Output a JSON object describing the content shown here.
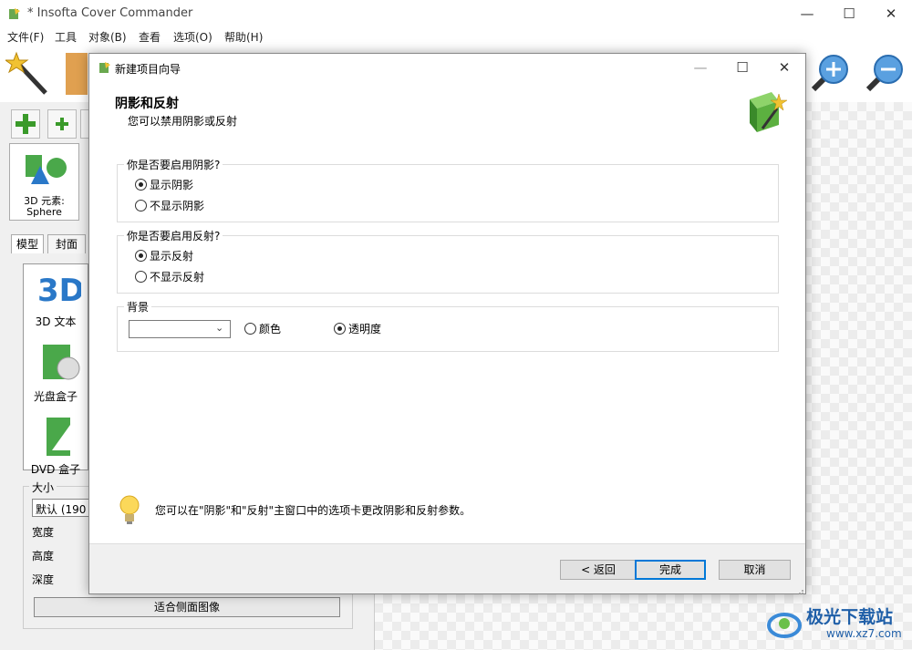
{
  "window": {
    "title": "* Insofta Cover Commander",
    "controls": [
      "—",
      "☐",
      "✕"
    ]
  },
  "menu": [
    "文件(F)",
    "工具",
    "对象(B)",
    "查看",
    "选项(O)",
    "帮助(H)"
  ],
  "left_panel": {
    "element_label_line1": "3D 元素:",
    "element_label_line2": "Sphere",
    "tabs": [
      "模型",
      "封面"
    ],
    "models": [
      "3D 文本",
      "光盘盒子",
      "DVD 盒子"
    ],
    "size_group": {
      "legend": "大小",
      "preset_value": "默认 (190 m",
      "fields": [
        "宽度",
        "高度",
        "深度"
      ],
      "fit_button": "适合侧面图像"
    }
  },
  "dialog": {
    "title": "新建项目向导",
    "controls": [
      "—",
      "☐",
      "✕"
    ],
    "header_title": "阴影和反射",
    "header_subtitle": "您可以禁用阴影或反射",
    "shadow": {
      "legend": "你是否要启用阴影?",
      "options": [
        "显示阴影",
        "不显示阴影"
      ],
      "selected": 0
    },
    "reflection": {
      "legend": "你是否要启用反射?",
      "options": [
        "显示反射",
        "不显示反射"
      ],
      "selected": 0
    },
    "background": {
      "legend": "背景",
      "dropdown_value": "",
      "options": [
        "颜色",
        "透明度"
      ],
      "selected": 1
    },
    "hint": "您可以在\"阴影\"和\"反射\"主窗口中的选项卡更改阴影和反射参数。",
    "buttons": {
      "back": "< 返回",
      "finish": "完成",
      "cancel": "取消"
    }
  },
  "watermark": {
    "name": "极光下载站",
    "url": "www.xz7.com"
  }
}
